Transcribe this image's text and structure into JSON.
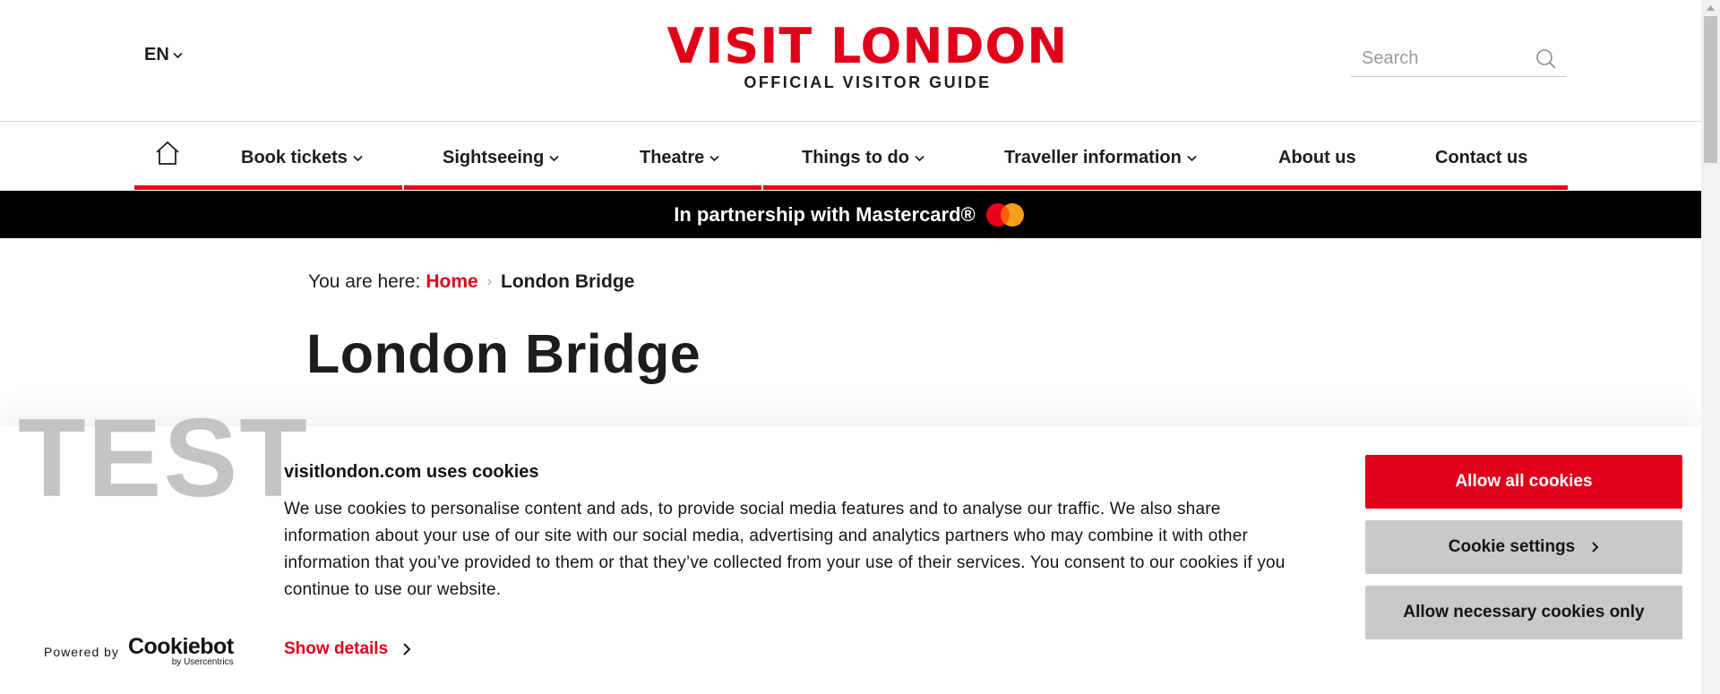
{
  "header": {
    "language": "EN",
    "logo_title": "VISIT LONDON",
    "logo_subtitle": "OFFICIAL VISITOR GUIDE",
    "search_placeholder": "Search",
    "brand_color": "#e1001a"
  },
  "nav": {
    "home_icon": "home-icon",
    "items": [
      {
        "label": "Book tickets",
        "has_dropdown": true
      },
      {
        "label": "Sightseeing",
        "has_dropdown": true
      },
      {
        "label": "Theatre",
        "has_dropdown": true
      },
      {
        "label": "Things to do",
        "has_dropdown": true
      },
      {
        "label": "Traveller information",
        "has_dropdown": true
      },
      {
        "label": "About us",
        "has_dropdown": false
      },
      {
        "label": "Contact us",
        "has_dropdown": false
      }
    ]
  },
  "partner_banner": {
    "text": "In partnership with Mastercard®",
    "logo": "mastercard-logo"
  },
  "breadcrumb": {
    "prefix": "You are here:",
    "home": "Home",
    "current": "London Bridge"
  },
  "page": {
    "title": "London Bridge"
  },
  "watermark": "TEST",
  "cookie_banner": {
    "title": "visitlondon.com uses cookies",
    "body": "We use cookies to personalise content and ads, to provide social media features and to analyse our traffic. We also share information about your use of our site with our social media, advertising and analytics partners who may combine it with other information that you’ve provided to them or that they’ve collected from your use of their services. You consent to our cookies if you continue to use our website.",
    "show_details": "Show details",
    "powered_by": "Powered by",
    "provider": "Cookiebot",
    "provider_sub": "by Usercentrics",
    "buttons": {
      "allow_all": "Allow all cookies",
      "settings": "Cookie settings",
      "necessary_only": "Allow necessary cookies only"
    }
  }
}
